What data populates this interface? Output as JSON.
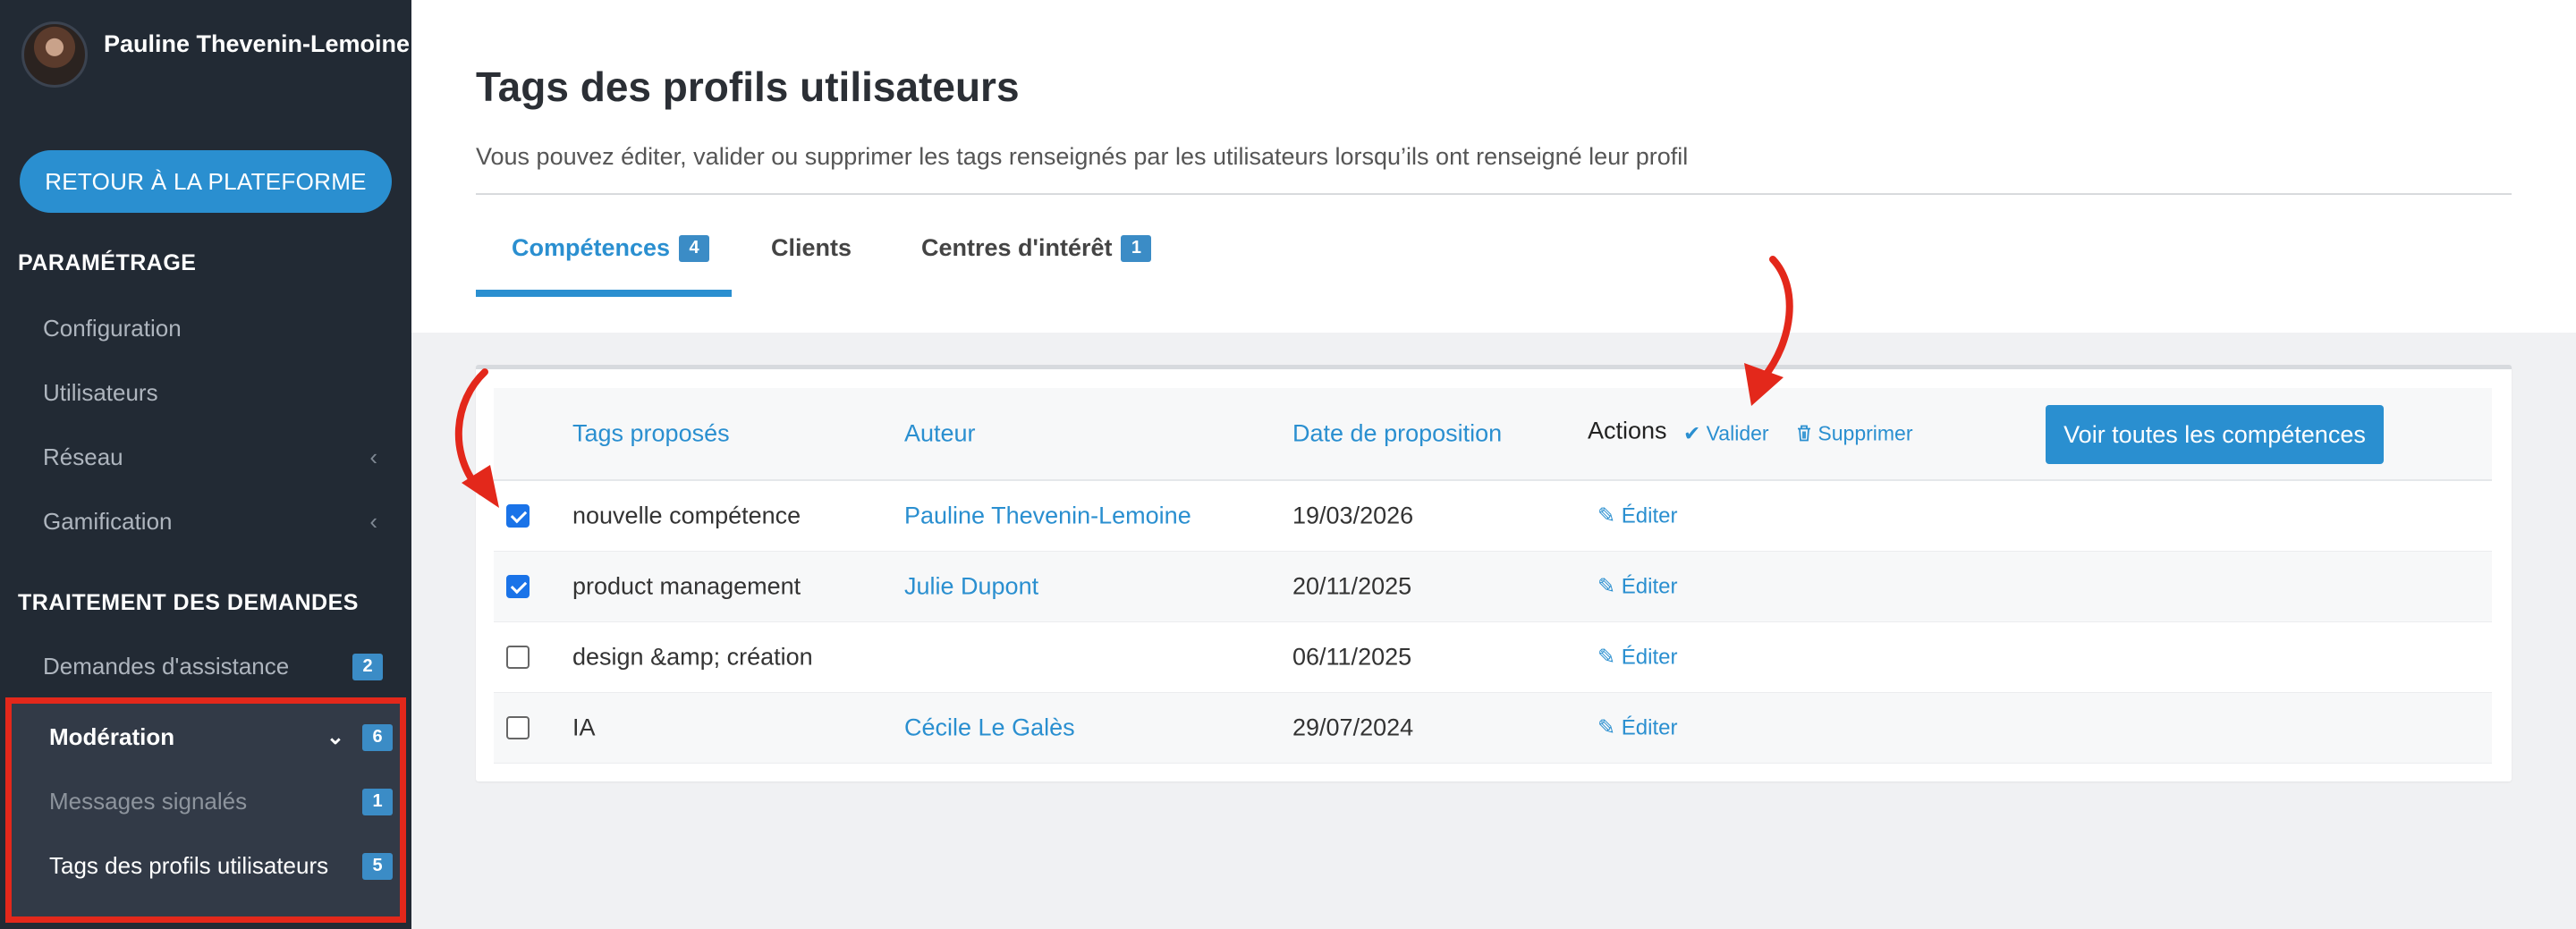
{
  "sidebar": {
    "user_name": "Pauline Thevenin-Lemoine",
    "back_button": "RETOUR À LA PLATEFORME",
    "section_settings": "PARAMÉTRAGE",
    "settings_items": [
      {
        "label": "Configuration"
      },
      {
        "label": "Utilisateurs"
      },
      {
        "label": "Réseau",
        "chevron": "‹"
      },
      {
        "label": "Gamification",
        "chevron": "‹"
      }
    ],
    "section_requests": "TRAITEMENT DES DEMANDES",
    "assistance": {
      "label": "Demandes d'assistance",
      "badge": "2"
    },
    "moderation": {
      "label": "Modération",
      "badge": "6",
      "chevron": "⌄"
    },
    "reported_messages": {
      "label": "Messages signalés",
      "badge": "1"
    },
    "profile_tags": {
      "label": "Tags des profils utilisateurs",
      "badge": "5"
    }
  },
  "main": {
    "title": "Tags des profils utilisateurs",
    "description": "Vous pouvez éditer, valider ou supprimer les tags renseignés par les utilisateurs lorsqu’ils ont renseigné leur profil",
    "tabs": [
      {
        "label": "Compétences",
        "badge": "4",
        "active": true
      },
      {
        "label": "Clients",
        "badge": ""
      },
      {
        "label": "Centres d'intérêt",
        "badge": "1"
      }
    ],
    "table": {
      "headers": {
        "tags": "Tags proposés",
        "author": "Auteur",
        "date": "Date de proposition",
        "actions": "Actions",
        "validate": "Valider",
        "delete": "Supprimer"
      },
      "see_all_button": "Voir toutes les compétences",
      "edit_label": "Éditer",
      "rows": [
        {
          "checked": true,
          "tag": "nouvelle compétence",
          "author": "Pauline Thevenin-Lemoine",
          "date": "19/03/2026"
        },
        {
          "checked": true,
          "tag": "product management",
          "author": "Julie Dupont",
          "date": "20/11/2025"
        },
        {
          "checked": false,
          "tag": "design &amp; création",
          "author": "",
          "date": "06/11/2025"
        },
        {
          "checked": false,
          "tag": "IA",
          "author": "Cécile Le Galès",
          "date": "29/07/2024"
        }
      ]
    }
  },
  "colors": {
    "sidebar_bg": "#222a34",
    "accent": "#2a8fd0",
    "highlight_red": "#e3281b"
  }
}
